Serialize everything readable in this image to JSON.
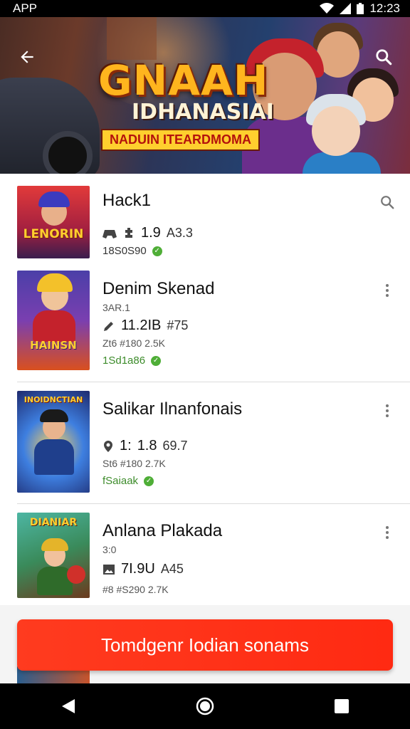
{
  "status_bar": {
    "app_label": "APP",
    "time": "12:23"
  },
  "banner": {
    "title": "GNAAH",
    "subtitle": "IDHANASIAI",
    "ribbon": "NADUIN ITEARDMOMA"
  },
  "items": [
    {
      "title": "Hack1",
      "meta_value": "1.9",
      "meta_extra": "A3.3",
      "sub": "",
      "green": "18S0S90",
      "thumb_label": "LENORIN",
      "action": "search"
    },
    {
      "title": "Denim Skenad",
      "tag": "3AR.1",
      "meta_value": "11.2IB",
      "meta_extra": "#75",
      "sub": "Zt6 #180 2.5K",
      "green": "1Sd1a86",
      "thumb_label": "HAINSN",
      "action": "more"
    },
    {
      "title": "Salikar Ilnanfonais",
      "meta_value": "1.8",
      "meta_prefix": "1:",
      "meta_extra": "69.7",
      "sub": "St6 #180 2.7K",
      "green": "fSaiaak",
      "thumb_label": "INOIDNCTIAN",
      "action": "more"
    },
    {
      "title": "Anlana Plakada",
      "tag": "3:0",
      "meta_value": "7I.9U",
      "meta_extra": "A45",
      "sub": "#8 #S290 2.7K",
      "green": "",
      "thumb_label": "DIANIAR",
      "action": "more"
    }
  ],
  "cta": {
    "label": "Tomdgenr Iodian sonams"
  },
  "colors": {
    "accent": "#ff2a12",
    "green": "#3d8c2b",
    "banner_gold": "#ffb51e"
  },
  "icons": [
    "back-arrow-icon",
    "search-icon",
    "more-vert-icon",
    "nav-back-icon",
    "nav-home-icon",
    "nav-recents-icon"
  ]
}
